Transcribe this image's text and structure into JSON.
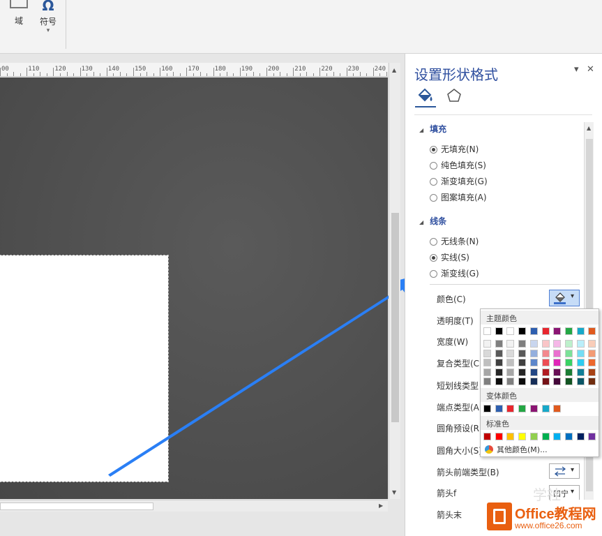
{
  "ribbon": {
    "field_label": "域",
    "symbol_label": "符号",
    "symbol_glyph": "Ω",
    "dropdown_glyph": "▾"
  },
  "ruler": {
    "labels": [
      "00",
      "110",
      "120",
      "130",
      "140",
      "150",
      "160",
      "170",
      "180",
      "190",
      "200",
      "210",
      "220",
      "230",
      "240"
    ]
  },
  "scroll": {
    "up": "▲",
    "down": "▼",
    "left": "◀",
    "right": "▶"
  },
  "panel": {
    "title": "设置形状格式",
    "dropdown_glyph": "▾",
    "close_glyph": "✕",
    "fill_section": "填充",
    "fill_options": [
      "无填充(N)",
      "纯色填充(S)",
      "渐变填充(G)",
      "图案填充(A)"
    ],
    "fill_selected": 0,
    "line_section": "线条",
    "line_options": [
      "无线条(N)",
      "实线(S)",
      "渐变线(G)"
    ],
    "line_selected": 1,
    "expand_glyph": "◢",
    "properties": [
      "颜色(C)",
      "透明度(T)",
      "宽度(W)",
      "复合类型(C)",
      "短划线类型(D)",
      "端点类型(A)",
      "圆角预设(R)",
      "圆角大小(S)",
      "箭头前端类型(B)",
      "箭头前端大小(I)",
      "箭头末端类型(E)"
    ],
    "visible_properties": [
      "颜色(C)",
      "透明度(T)",
      "宽度(W)",
      "复合类型(C)",
      "短划线类型",
      "端点类型(A)",
      "圆角预设(R)",
      "圆角大小(S)",
      "箭头前端类型(B)",
      "箭头f",
      "箭头末"
    ],
    "ctrl_button_text": "凹宁"
  },
  "color_dropdown": {
    "theme_header": "主题颜色",
    "variant_header": "变体颜色",
    "standard_header": "标准色",
    "more_colors": "其他颜色(M)...",
    "theme_top": [
      "#ffffff",
      "#000000",
      "#ffffff",
      "#000000",
      "#2e5faf",
      "#e8262e",
      "#8b1573",
      "#24a745",
      "#17a9c9",
      "#e05a1e"
    ],
    "theme_shades": [
      [
        "#f2f2f2",
        "#d9d9d9",
        "#bfbfbf",
        "#a6a6a6",
        "#808080"
      ],
      [
        "#7f7f7f",
        "#595959",
        "#404040",
        "#262626",
        "#0d0d0d"
      ],
      [
        "#f2f2f2",
        "#d9d9d9",
        "#bfbfbf",
        "#a6a6a6",
        "#808080"
      ],
      [
        "#7f7f7f",
        "#595959",
        "#404040",
        "#262626",
        "#0d0d0d"
      ],
      [
        "#c9d6ee",
        "#94afdd",
        "#5e87cb",
        "#234785",
        "#172f59"
      ],
      [
        "#f9c5c7",
        "#f3898e",
        "#ed4e55",
        "#b11c22",
        "#761217"
      ],
      [
        "#f5b7e7",
        "#ea6fcf",
        "#e026b8",
        "#680f56",
        "#45093a"
      ],
      [
        "#bdf0cb",
        "#7be198",
        "#3ad264",
        "#1b7d34",
        "#125422"
      ],
      [
        "#baeefa",
        "#74ddf4",
        "#2fccef",
        "#117f97",
        "#0b5565"
      ],
      [
        "#f9cdb9",
        "#f39b74",
        "#ed682e",
        "#a84316",
        "#702d0f"
      ]
    ],
    "variant": [
      "#000000",
      "#2e5faf",
      "#e8262e",
      "#24a745",
      "#8b1573",
      "#17a9c9",
      "#e05a1e"
    ],
    "standard": [
      "#c00000",
      "#ff0000",
      "#ffc000",
      "#ffff00",
      "#92d050",
      "#00b050",
      "#00b0f0",
      "#0070c0",
      "#002060",
      "#7030a0"
    ]
  },
  "arrow_color": "#2a7ff5",
  "watermark": {
    "brand": "Office教程网",
    "url": "www.office26.com",
    "ghost_text": "学社"
  }
}
